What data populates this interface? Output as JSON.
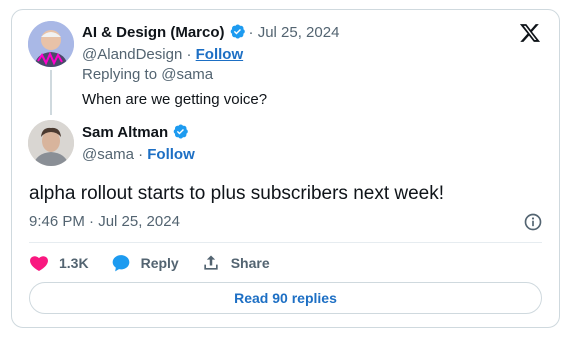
{
  "reply_tweet": {
    "display_name": "AI & Design (Marco)",
    "separator": "·",
    "date": "Jul 25, 2024",
    "handle": "@AlandDesign",
    "follow_label": "Follow",
    "replying_to": "Replying to @sama",
    "text": "When are we getting voice?"
  },
  "main_tweet": {
    "display_name": "Sam Altman",
    "handle": "@sama",
    "separator": "·",
    "follow_label": "Follow",
    "text": "alpha rollout starts to plus subscribers next week!",
    "timestamp": "9:46 PM · Jul 25, 2024"
  },
  "actions": {
    "like_count": "1.3K",
    "reply_label": "Reply",
    "share_label": "Share"
  },
  "read_replies_label": "Read 90 replies",
  "colors": {
    "accent": "#1d6fc4",
    "verified": "#1d9bf0",
    "like": "#f91880",
    "muted": "#536471",
    "border": "#cfd9de"
  },
  "icons": [
    "x-logo-icon",
    "verified-badge-icon",
    "info-icon",
    "heart-icon",
    "reply-bubble-icon",
    "share-icon"
  ]
}
